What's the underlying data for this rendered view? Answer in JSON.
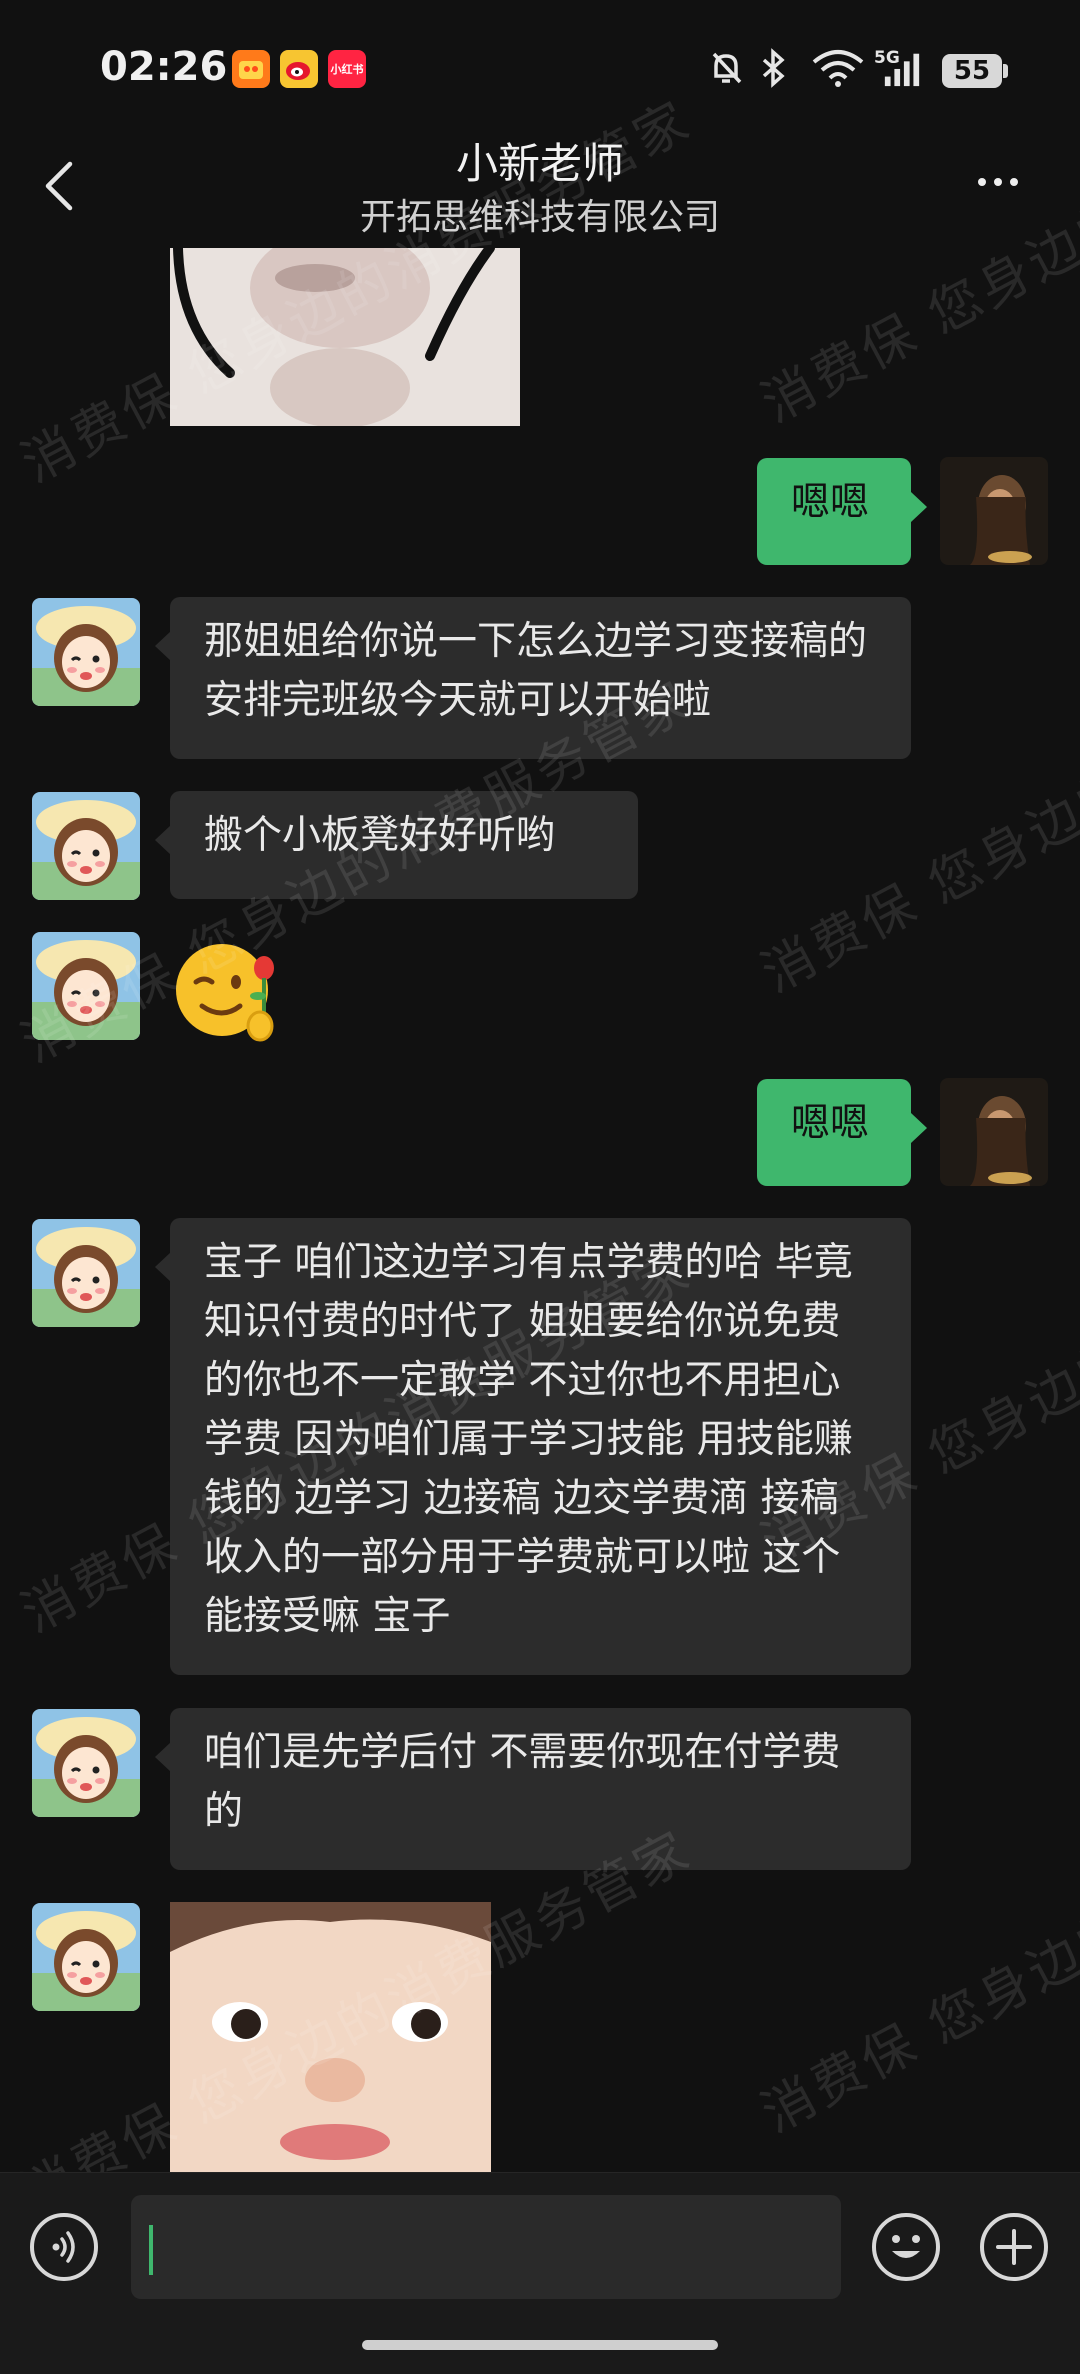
{
  "status_bar": {
    "time": "02:26",
    "apps": [
      "taobao-app",
      "weibo-app",
      "xiaohongshu-app"
    ],
    "xhs_label": "小红书",
    "network": "5G",
    "battery": "55"
  },
  "header": {
    "title": "小新老师",
    "subtitle": "开拓思维科技有限公司"
  },
  "messages": [
    {
      "from": "other",
      "type": "image",
      "content": "meme-image-cropped"
    },
    {
      "from": "me",
      "type": "text",
      "text": "嗯嗯"
    },
    {
      "from": "other",
      "type": "text",
      "text": " 那姐姐给你说一下怎么边学习变接稿的 安排完班级今天就可以开始啦"
    },
    {
      "from": "other",
      "type": "text",
      "text": "搬个小板凳好好听哟"
    },
    {
      "from": "other",
      "type": "emoji",
      "content": "rose-wink-emoji"
    },
    {
      "from": "me",
      "type": "text",
      "text": "嗯嗯"
    },
    {
      "from": "other",
      "type": "text",
      "text": "宝子  咱们这边学习有点学费的哈 毕竟知识付费的时代了 姐姐要给你说免费的你也不一定敢学 不过你也不用担心学费 因为咱们属于学习技能 用技能赚钱的  边学习 边接稿  边交学费滴 接稿收入的一部分用于学费就可以啦  这个能接受嘛 宝子"
    },
    {
      "from": "other",
      "type": "text",
      "text": "咱们是先学后付 不需要你现在付学费的"
    },
    {
      "from": "other",
      "type": "image",
      "content": "baby-face-image"
    }
  ],
  "watermark": {
    "lines": [
      "消费保  您身边的消费服务管家"
    ]
  },
  "input_bar": {
    "placeholder": ""
  },
  "colors": {
    "background": "#111111",
    "bubble_other": "#2c2c2c",
    "bubble_me": "#3fb76d",
    "accent": "#3fb76d"
  }
}
